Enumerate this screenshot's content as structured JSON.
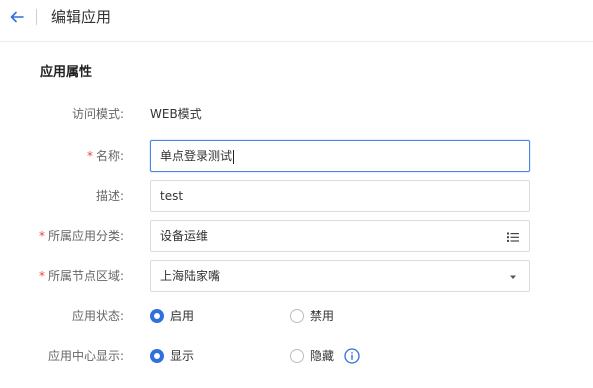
{
  "header": {
    "title": "编辑应用"
  },
  "section": {
    "title": "应用属性"
  },
  "fields": {
    "access_mode": {
      "label": "访问模式:",
      "value": "WEB模式"
    },
    "name": {
      "label": "名称:",
      "value": "单点登录测试"
    },
    "description": {
      "label": "描述:",
      "value": "test"
    },
    "category": {
      "label": "所属应用分类:",
      "value": "设备运维"
    },
    "region": {
      "label": "所属节点区域:",
      "value": "上海陆家嘴"
    },
    "status": {
      "label": "应用状态:",
      "options": [
        "启用",
        "禁用"
      ],
      "selected": "启用"
    },
    "center_display": {
      "label": "应用中心显示:",
      "options": [
        "显示",
        "隐藏"
      ],
      "selected": "显示"
    }
  },
  "required_mark": "*",
  "colors": {
    "accent": "#2f6fe0",
    "required": "#e74c3c",
    "focus_border": "#4a86e8"
  },
  "icons": {
    "back": "arrow-left-icon",
    "category": "list-icon",
    "region": "caret-down-icon",
    "info": "info-circle-icon"
  }
}
